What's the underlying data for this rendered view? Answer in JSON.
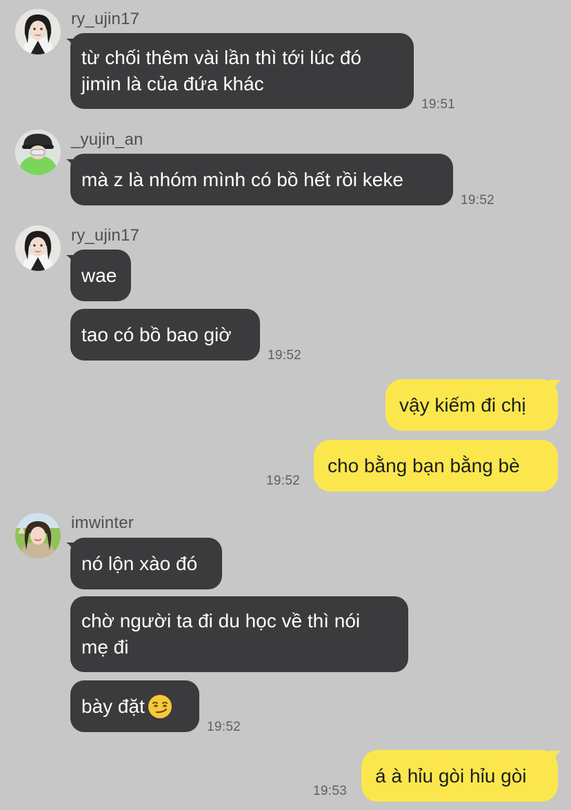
{
  "colors": {
    "background": "#c7c7c7",
    "incoming_bubble": "#3b3b3d",
    "outgoing_bubble": "#fbe74d",
    "timestamp": "#5f5f5f",
    "sender_name": "#4f4f4f"
  },
  "messages": [
    {
      "sender": "ry_ujin17",
      "text": "từ chối thêm vài lần thì tới lúc đó\njimin là của đứa khác",
      "time": "19:51"
    },
    {
      "sender": "_yujin_an",
      "text": "mà z là nhóm mình có bồ hết rồi keke",
      "time": "19:52"
    },
    {
      "sender": "ry_ujin17",
      "text": "wae"
    },
    {
      "text": "tao có bồ bao giờ",
      "time": "19:52"
    },
    {
      "text": "vậy kiếm đi chị"
    },
    {
      "text": "cho bằng bạn bằng bè",
      "time": "19:52"
    },
    {
      "sender": "imwinter",
      "text": "nó lộn xào đó"
    },
    {
      "text": "chờ người ta đi du học về thì nói\nmẹ đi"
    },
    {
      "text": "bày đặt",
      "emoji": "smirking-face-emoji",
      "time": "19:52"
    },
    {
      "text": "á à hỉu gòi hỉu gòi",
      "time": "19:53"
    }
  ]
}
